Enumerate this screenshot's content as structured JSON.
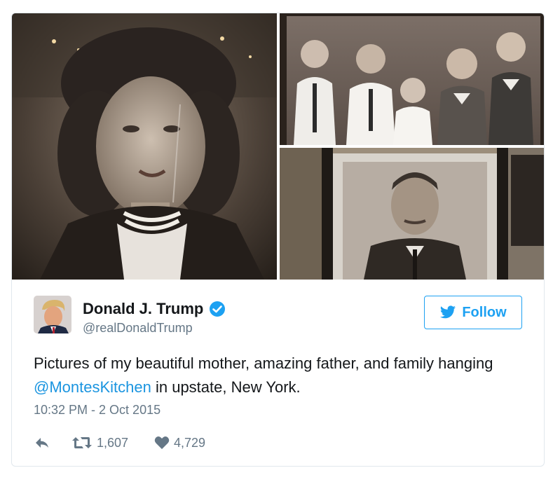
{
  "tweet": {
    "author": {
      "display_name": "Donald J. Trump",
      "handle": "@realDonaldTrump",
      "verified": true
    },
    "follow_label": "Follow",
    "text_before": "Pictures of my beautiful mother, amazing father, and family hanging ",
    "mention": "@MontesKitchen",
    "text_after": " in upstate, New York.",
    "timestamp": "10:32 PM - 2 Oct 2015",
    "retweets": "1,607",
    "likes": "4,729"
  },
  "media": {
    "photo_count": 3
  },
  "colors": {
    "accent": "#1da1f2",
    "link": "#1b95e0",
    "text": "#14171a",
    "muted": "#657786",
    "border": "#e1e8ed"
  },
  "icons": {
    "verified": "verified-badge-icon",
    "follow": "twitter-bird-icon",
    "reply": "reply-icon",
    "retweet": "retweet-icon",
    "like": "heart-icon"
  }
}
